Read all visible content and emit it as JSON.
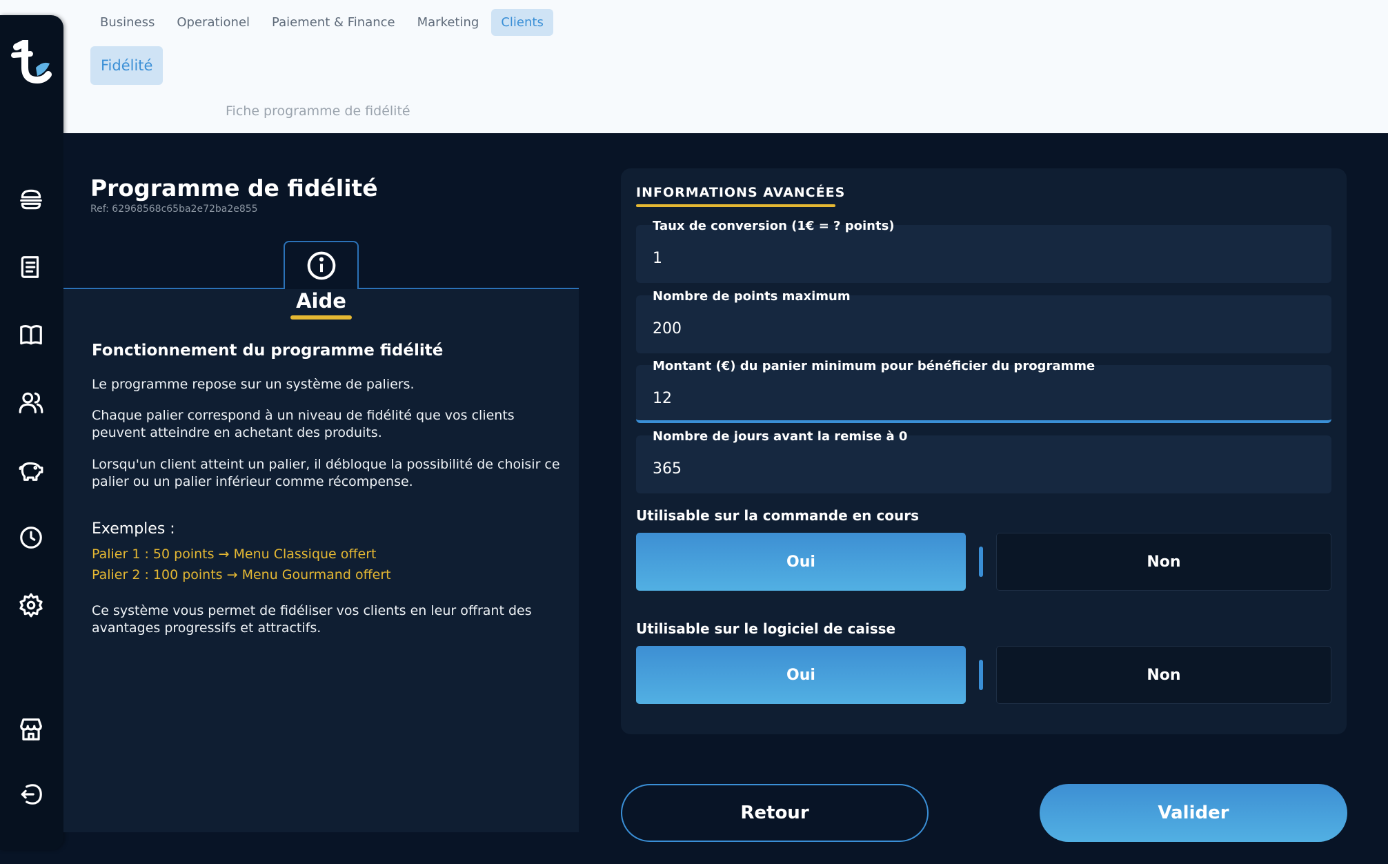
{
  "nav": {
    "tabs": [
      {
        "label": "Business"
      },
      {
        "label": "Operationel"
      },
      {
        "label": "Paiement & Finance"
      },
      {
        "label": "Marketing"
      },
      {
        "label": "Clients"
      }
    ],
    "active_tab": "Clients",
    "subtab": "Fidélité",
    "page_subtitle": "Fiche programme de fidélité"
  },
  "sidebar": {
    "icons": [
      "burger-icon",
      "receipt-icon",
      "book-icon",
      "users-icon",
      "piggy-bank-icon",
      "clock-icon",
      "gear-icon",
      "store-icon",
      "logout-icon"
    ]
  },
  "program": {
    "title": "Programme de fidélité",
    "ref": "Ref: 62968568c65ba2e72ba2e855"
  },
  "help": {
    "tab_label": "Aide",
    "heading": "Fonctionnement du programme fidélité",
    "p1": "Le programme repose sur un système de paliers.",
    "p2": "Chaque palier correspond à un niveau de fidélité que vos clients peuvent atteindre en achetant des produits.",
    "p3": "Lorsqu'un client atteint un palier, il débloque la possibilité de choisir ce palier ou un palier inférieur comme récompense.",
    "examples_heading": "Exemples :",
    "example1": "Palier 1 : 50 points → Menu Classique offert",
    "example2": "Palier 2 : 100 points → Menu Gourmand offert",
    "p4": "Ce système vous permet de fidéliser vos clients en leur offrant des avantages progressifs et attractifs."
  },
  "form": {
    "section_title": "INFORMATIONS AVANCÉES",
    "fields": [
      {
        "label": "Taux de conversion (1€ = ? points)",
        "value": "1"
      },
      {
        "label": "Nombre de points maximum",
        "value": "200"
      },
      {
        "label": "Montant (€) du panier minimum pour bénéficier du programme",
        "value": "12"
      },
      {
        "label": "Nombre de jours avant la remise à 0",
        "value": "365"
      }
    ],
    "toggle1": {
      "label": "Utilisable sur la commande en cours",
      "yes": "Oui",
      "no": "Non",
      "selected": "Oui"
    },
    "toggle2": {
      "label": "Utilisable sur le logiciel de caisse",
      "yes": "Oui",
      "no": "Non",
      "selected": "Oui"
    }
  },
  "actions": {
    "back": "Retour",
    "validate": "Valider"
  },
  "colors": {
    "accent": "#3a8fd6",
    "highlight": "#e5b833",
    "panel": "#0f1e32",
    "background": "#081426"
  }
}
